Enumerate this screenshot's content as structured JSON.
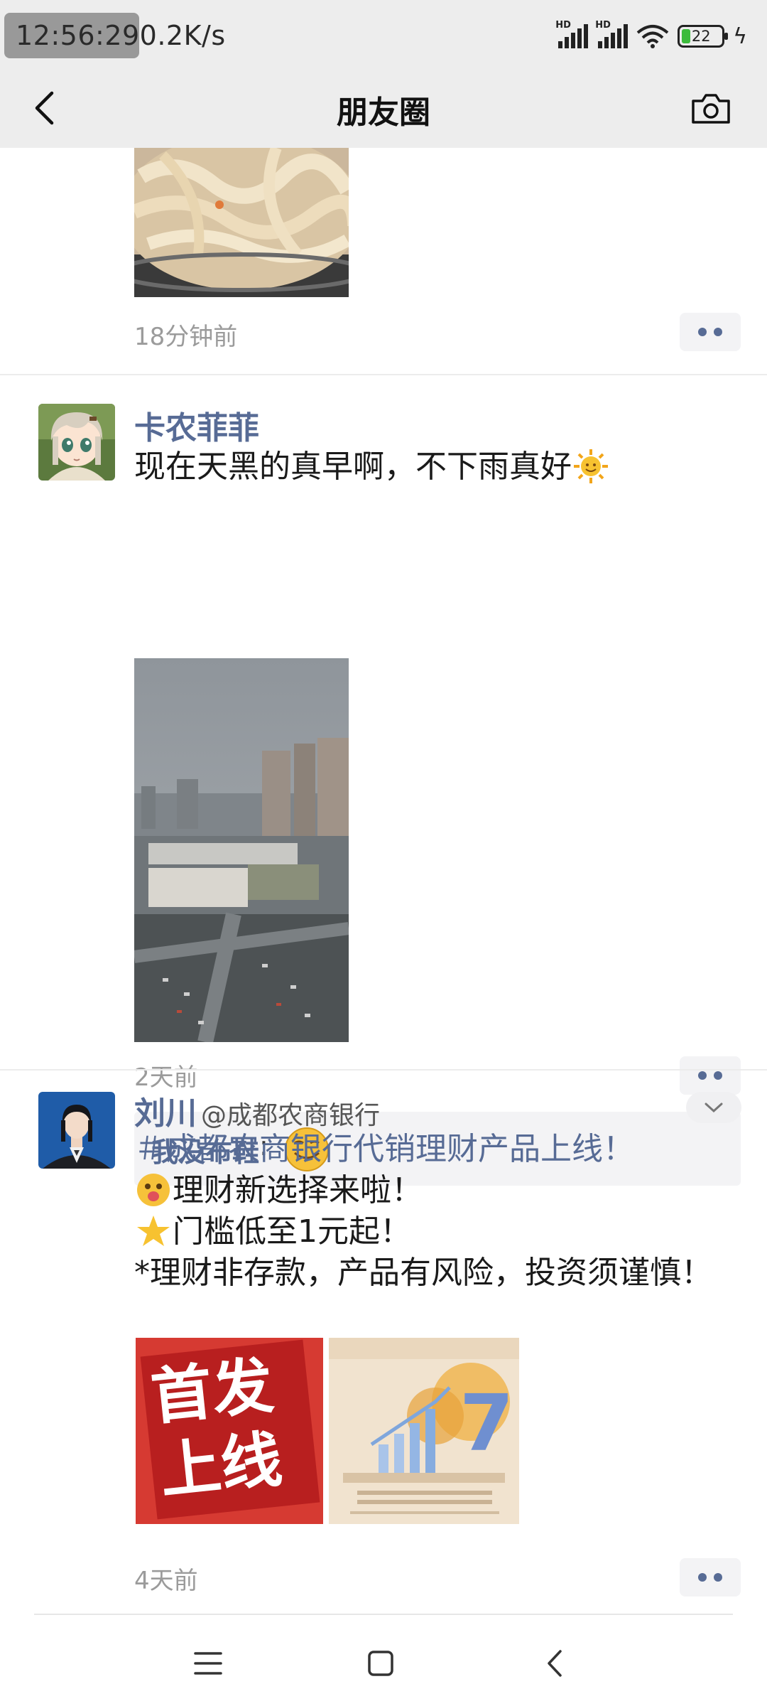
{
  "status_bar": {
    "clock_speed_text": "12:56:290.2K/s",
    "battery_level": "22",
    "signal_labels": [
      "HD",
      "HD"
    ]
  },
  "header": {
    "title": "朋友圈"
  },
  "posts": [
    {
      "time": "18分钟前"
    },
    {
      "author": "卡农菲菲",
      "text": "现在天黑的真早啊，不下雨真好",
      "time": "2天前",
      "comment": {
        "name": "我没布鞋",
        "separator": ":"
      }
    },
    {
      "author": "刘川",
      "author_suffix": "@成都农商银行",
      "lines": [
        "＃成都农商银行代销理财产品上线！",
        "理财新选择来啦！",
        "门槛低至1元起！",
        "*理财非存款，产品有风险，投资须谨慎！"
      ],
      "image_1_text": [
        "首发",
        "上线"
      ],
      "image_2_text": "7",
      "time": "4天前"
    }
  ],
  "colors": {
    "link_blue": "#576b95",
    "header_bg": "#ededed",
    "time_gray": "#9b9b9b"
  },
  "icons": [
    "back-arrow-icon",
    "camera-icon",
    "more-dots-icon",
    "sun-emoji-icon",
    "smile-emoji-icon",
    "tongue-emoji-icon",
    "star-emoji-icon",
    "menu-icon",
    "home-square-icon",
    "nav-back-icon",
    "chevron-down-icon",
    "wifi-icon",
    "signal-icon",
    "battery-icon",
    "charging-icon"
  ]
}
